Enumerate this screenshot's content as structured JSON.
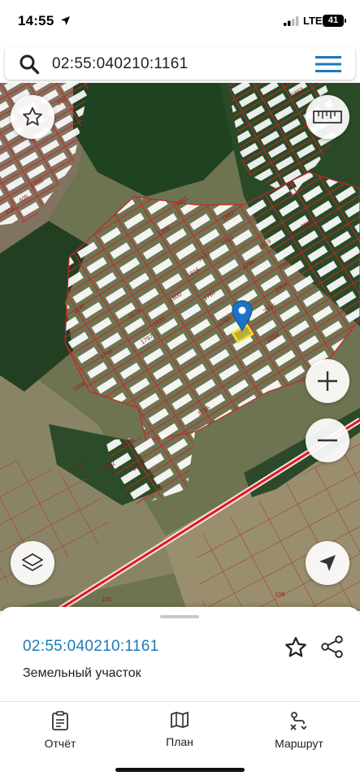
{
  "status_bar": {
    "time": "14:55",
    "network": "LTE",
    "battery": "41"
  },
  "search": {
    "query": "02:55:040210:1161"
  },
  "map": {
    "selected_parcel_color": "#f4e22a",
    "parcel_outline_color": "#d0282a",
    "road_color": "#e31a1c",
    "marker_color": "#1a73c9",
    "parcel_labels": [
      "1147",
      "3176",
      "1906",
      "4436",
      "3482",
      "108",
      "132",
      "1930",
      "405",
      "418",
      "316",
      "1863",
      "1819",
      "2316",
      "1798",
      "2264",
      "2346",
      "1695",
      "1840",
      "2367",
      "1796",
      "1632",
      "1797",
      "1861",
      "1816",
      "2364",
      "1862",
      "1812",
      "1787",
      "2380",
      "1825",
      "1780",
      "1800",
      "1736"
    ]
  },
  "parcel": {
    "cadastral_number": "02:55:040210:1161",
    "type": "Земельный участок"
  },
  "bottom_nav": {
    "tabs": [
      {
        "label": "Отчёт",
        "icon": "clipboard-icon"
      },
      {
        "label": "План",
        "icon": "map-icon"
      },
      {
        "label": "Маршрут",
        "icon": "route-icon"
      }
    ]
  },
  "colors": {
    "accent": "#1c7ab8",
    "menu": "#1c7ab8"
  }
}
